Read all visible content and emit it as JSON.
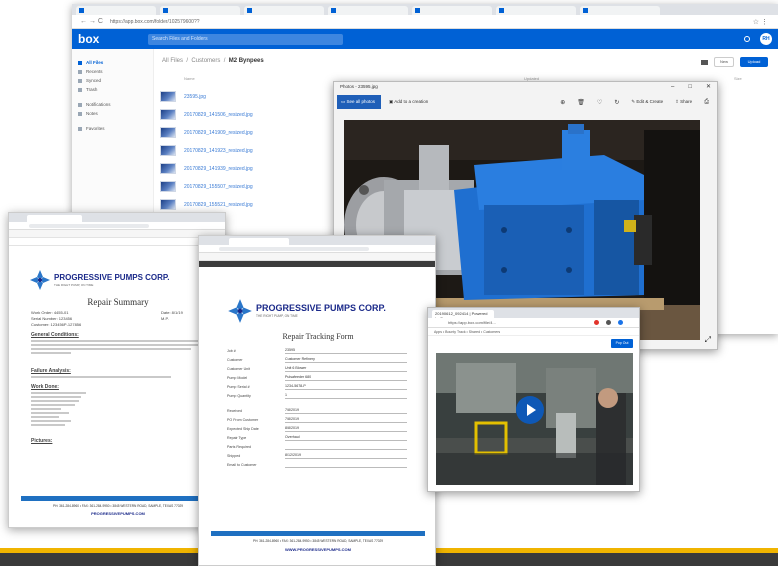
{
  "box_window": {
    "url": "https://app.box.com/folder/102579600??",
    "logo": "box",
    "search_placeholder": "Search Files and Folders",
    "avatar": "RH",
    "sidebar": [
      {
        "label": "All Files",
        "active": true
      },
      {
        "label": "Recents"
      },
      {
        "label": "Synced"
      },
      {
        "label": "Trash"
      },
      {
        "label": "Notifications"
      },
      {
        "label": "Notes"
      },
      {
        "label": "Favorites"
      }
    ],
    "breadcrumb": {
      "root": "All Files",
      "middle": "Customers",
      "current": "M2 Bynpees"
    },
    "columns": {
      "name": "Name",
      "updated": "Updated",
      "size": "Size"
    },
    "files": [
      "23595.jpg",
      "20170829_141506_resized.jpg",
      "20170829_141909_resized.jpg",
      "20170829_141923_resized.jpg",
      "20170829_141939_resized.jpg",
      "20170829_155507_resized.jpg",
      "20170829_155521_resized.jpg",
      "23595.jpg"
    ],
    "new_button": "New",
    "upload_button": "Upload"
  },
  "photos_window": {
    "title": "Photos - 23595.jpg",
    "see_all": "See all photos",
    "add_creation": "Add to a creation",
    "edit_create": "Edit & Create",
    "share": "Share"
  },
  "doc1": {
    "brand": "PROGRESSIVE PUMPS CORP.",
    "tagline": "THE RIGHT PUMP, ON TIME",
    "title": "Repair Summary",
    "fields": [
      {
        "label": "Work Order: 4455-01",
        "right": "Date: 8/1/19"
      },
      {
        "label": "Serial Number: 123456",
        "right": "M.P."
      },
      {
        "label": "Customer: 123456P-127856",
        "right": ""
      }
    ],
    "sections": [
      "General Conditions:",
      "Failure Analysis:",
      "Work Done:",
      "Pictures:"
    ],
    "footer": "PH: 361-284-8960 • FAX: 361-284-9950 • 3845 WESTERN ROAD, SAMPLE, TEXAS 77029",
    "website": "PROGRESSIVEPUMPS.COM"
  },
  "doc2": {
    "brand": "PROGRESSIVE PUMPS CORP.",
    "tagline": "THE RIGHT PUMP, ON TIME",
    "title": "Repair Tracking Form",
    "fields": [
      {
        "label": "Job #",
        "value": "23595"
      },
      {
        "label": "Customer",
        "value": "Customer Refinery"
      },
      {
        "label": "Customer Unit",
        "value": "Unit 6 Blower"
      },
      {
        "label": "Pump Model",
        "value": "Pulsafeeder 680"
      },
      {
        "label": "Pump Serial #",
        "value": "1234-5678-P"
      },
      {
        "label": "Pump Quantity",
        "value": "1"
      },
      {
        "label": "Received",
        "value": "7/8/2019"
      },
      {
        "label": "PO From Customer",
        "value": "7/8/2019"
      },
      {
        "label": "Expected Ship Date",
        "value": "8/8/2019"
      },
      {
        "label": "Repair Type",
        "value": "Overhaul"
      },
      {
        "label": "Parts Required",
        "value": ""
      },
      {
        "label": "Shipped",
        "value": "8/12/2019"
      },
      {
        "label": "Email to Customer",
        "value": ""
      }
    ],
    "footer": "PH: 361-284-8960 • FAX: 361-284-9950 • 3845 WESTERN ROAD, SAMPLE, TEXAS 77029",
    "website": "WWW.PROGRESSIVEPUMPS.COM"
  },
  "video_window": {
    "tab": "20190612_092414 | Powered by Box",
    "url": "https://app.box.com/file/4...",
    "bookmarks": "Apps • Bounty Track • Shared • Customers",
    "open_button": "Pop Out"
  },
  "colors": {
    "box_blue": "#0061d5",
    "pump_blue": "#1f6fd0",
    "brand_navy": "#1b2a8a",
    "footer_band": "#1f70c1",
    "bottom_yellow": "#f0b400"
  }
}
